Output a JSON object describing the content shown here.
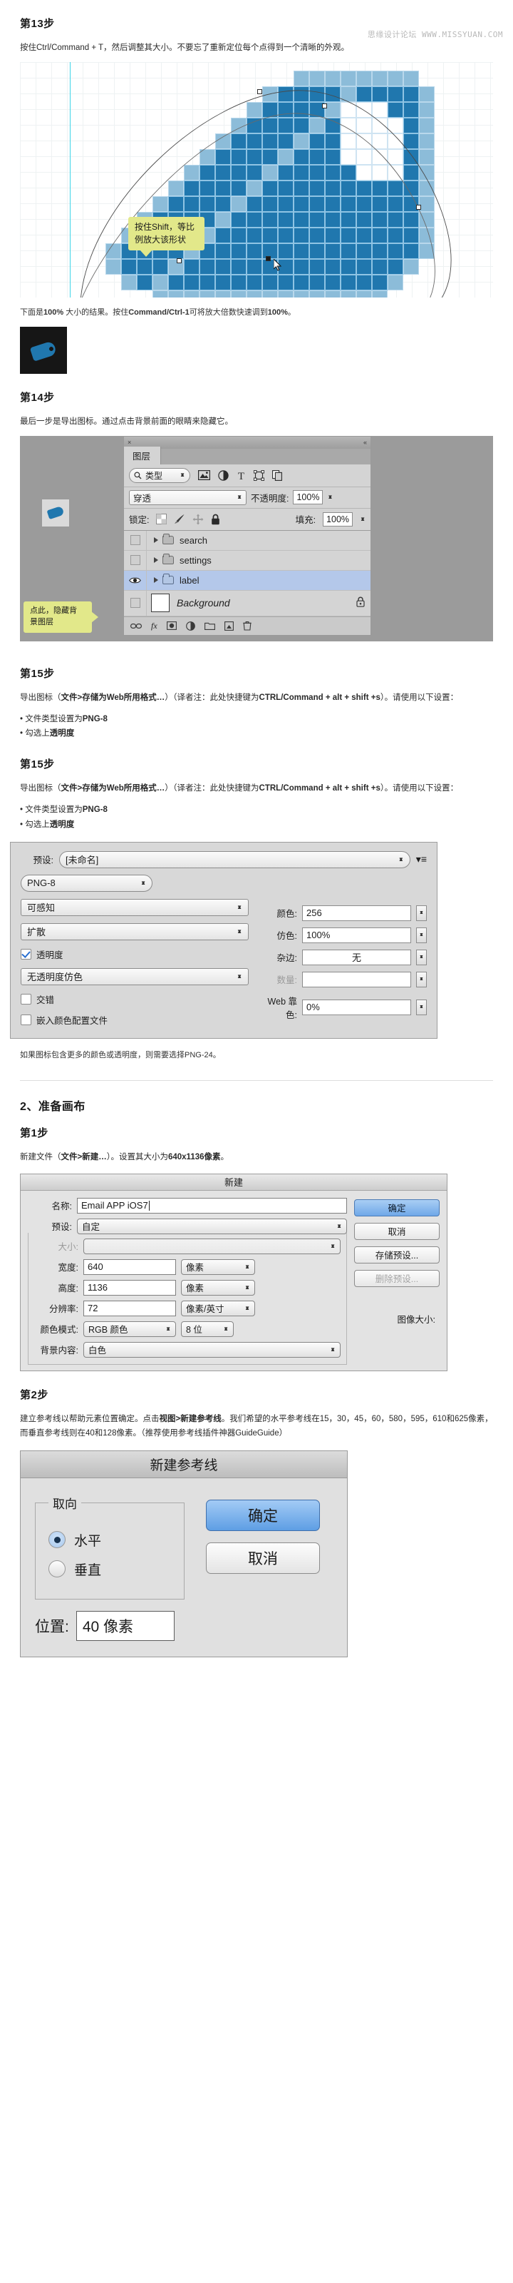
{
  "watermark": "思缘设计论坛 WWW.MISSYUAN.COM",
  "sections": {
    "step13": {
      "heading": "第13步",
      "body": "按住Ctrl/Command + T，然后调整其大小。不要忘了重新定位每个点得到一个清晰的外观。",
      "tooltip": "按住Shift，等比\n例放大该形状",
      "after_note": "下面是100% 大小的结果。按住Command/Ctrl-1可将放大倍数快速调到100%。"
    },
    "step14": {
      "heading": "第14步",
      "body": "最后一步是导出图标。通过点击背景前面的眼睛来隐藏它。",
      "tooltip": "点此，隐藏背\n景图层"
    },
    "step15a": {
      "heading": "第15步",
      "body": "导出图标（文件>存储为Web所用格式…）（译者注：此处快捷键为CTRL/Command + alt + shift +s）。请使用以下设置：",
      "bullets": [
        "文件类型设置为PNG-8",
        "勾选上透明度"
      ]
    },
    "step15b": {
      "heading": "第15步",
      "body": "导出图标（文件>存储为Web所用格式…）（译者注：此处快捷键为CTRL/Command + alt + shift +s）。请使用以下设置：",
      "bullets": [
        "文件类型设置为PNG-8",
        "勾选上透明度"
      ],
      "footer": "如果图标包含更多的颜色或透明度，则需要选择PNG-24。"
    },
    "section2": {
      "heading": "2、准备画布"
    },
    "step1": {
      "heading": "第1步",
      "body": "新建文件（文件>新建…）。设置其大小为640x1136像素。"
    },
    "step2": {
      "heading": "第2步",
      "body": "建立参考线以帮助元素位置确定。点击视图>新建参考线。我们希望的水平参考线在15，30，45，60，580，595，610和625像素，而垂直参考线则在40和128像素。（推荐使用参考线插件神器GuideGuide）"
    }
  },
  "layers_panel": {
    "tab_label": "图层",
    "close_icon": "×",
    "menu_icon": "≡",
    "collapse_icon": "«",
    "filter_label": "类型",
    "filter_icons": [
      "image-icon",
      "adjustment-icon",
      "type-icon",
      "shape-icon",
      "smartobject-icon"
    ],
    "blend_mode": "穿透",
    "opacity_label": "不透明度:",
    "opacity_value": "100%",
    "lock_label": "锁定:",
    "lock_icons": [
      "transparency-lock-icon",
      "brush-lock-icon",
      "move-lock-icon",
      "all-lock-icon"
    ],
    "fill_label": "填充:",
    "fill_value": "100%",
    "rows": [
      {
        "name": "search",
        "type": "group",
        "visible": false,
        "selected": false
      },
      {
        "name": "settings",
        "type": "group",
        "visible": false,
        "selected": false
      },
      {
        "name": "label",
        "type": "group",
        "visible": true,
        "selected": true
      },
      {
        "name": "Background",
        "type": "background",
        "visible": false,
        "selected": false,
        "locked": true
      }
    ],
    "bottom_icons": [
      "link-icon",
      "fx-icon",
      "mask-icon",
      "adjustment-icon",
      "group-icon",
      "new-layer-icon",
      "trash-icon"
    ]
  },
  "save_for_web": {
    "preset_label": "预设:",
    "preset_value": "[未命名]",
    "format": "PNG-8",
    "color_reduction": "可感知",
    "dither_algorithm": "扩散",
    "transparency_label": "透明度",
    "transparency_checked": true,
    "transparency_dither": "无透明度仿色",
    "interlaced_label": "交错",
    "interlaced_checked": false,
    "embed_profile_label": "嵌入颜色配置文件",
    "embed_profile_checked": false,
    "colors_label": "颜色:",
    "colors_value": "256",
    "dither_label": "仿色:",
    "dither_value": "100%",
    "matte_label": "杂边:",
    "matte_value": "无",
    "amount_label": "数量:",
    "amount_value": "",
    "web_snap_label": "Web 靠色:",
    "web_snap_value": "0%"
  },
  "new_document": {
    "title": "新建",
    "name_label": "名称:",
    "name_value": "Email APP iOS7",
    "preset_label": "预设:",
    "preset_value": "自定",
    "size_label": "大小:",
    "size_value": "",
    "width_label": "宽度:",
    "width_value": "640",
    "width_unit": "像素",
    "height_label": "高度:",
    "height_value": "1136",
    "height_unit": "像素",
    "resolution_label": "分辨率:",
    "resolution_value": "72",
    "resolution_unit": "像素/英寸",
    "color_mode_label": "颜色模式:",
    "color_mode_value": "RGB 颜色",
    "bit_depth_value": "8 位",
    "background_label": "背景内容:",
    "background_value": "白色",
    "image_size_label": "图像大小:",
    "buttons": {
      "ok": "确定",
      "cancel": "取消",
      "save_preset": "存储预设...",
      "delete_preset": "删除预设..."
    }
  },
  "new_guide": {
    "title": "新建参考线",
    "orientation_label": "取向",
    "horizontal_label": "水平",
    "vertical_label": "垂直",
    "orientation_selected": "水平",
    "position_label": "位置:",
    "position_value": "40 像素",
    "buttons": {
      "ok": "确定",
      "cancel": "取消"
    }
  },
  "colors": {
    "tag_dark": "#2077ae",
    "tag_light": "#8cbcd9",
    "guide_cyan": "#3fd4e8",
    "tooltip_yellow": "#e2e88a",
    "selection_blue": "#b4c8ea"
  }
}
